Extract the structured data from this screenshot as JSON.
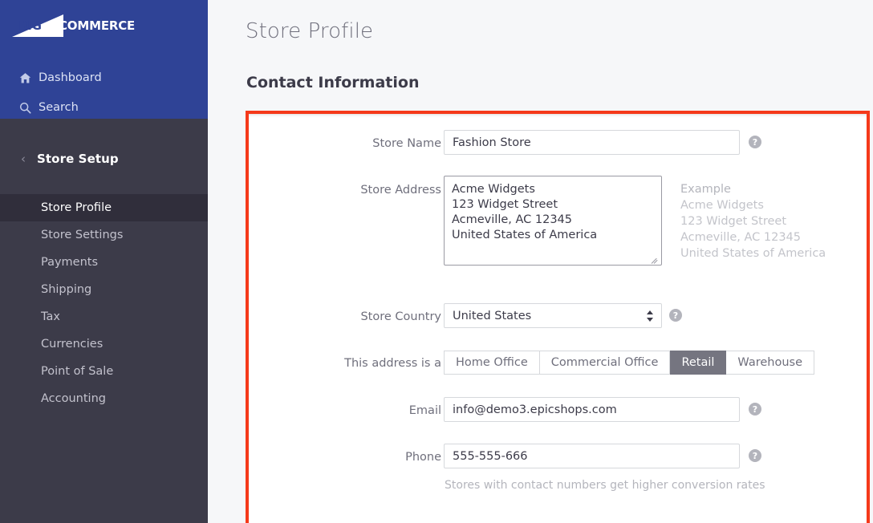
{
  "brand": {
    "logo_big": "BIG",
    "logo_rest": "COMMERCE"
  },
  "sidebar": {
    "top_items": [
      {
        "label": "Dashboard",
        "icon": "home-icon"
      },
      {
        "label": "Search",
        "icon": "search-icon"
      }
    ],
    "section": {
      "label": "Store Setup",
      "back_icon": "chevron-left-icon"
    },
    "items": [
      {
        "label": "Store Profile",
        "active": true
      },
      {
        "label": "Store Settings",
        "active": false
      },
      {
        "label": "Payments",
        "active": false
      },
      {
        "label": "Shipping",
        "active": false
      },
      {
        "label": "Tax",
        "active": false
      },
      {
        "label": "Currencies",
        "active": false
      },
      {
        "label": "Point of Sale",
        "active": false
      },
      {
        "label": "Accounting",
        "active": false
      }
    ]
  },
  "main": {
    "page_title": "Store Profile",
    "section_title": "Contact Information"
  },
  "form": {
    "store_name": {
      "label": "Store Name",
      "value": "Fashion Store",
      "help_icon": "question-mark-icon"
    },
    "store_address": {
      "label": "Store Address",
      "value": "Acme Widgets\n123 Widget Street\nAcmeville, AC 12345\nUnited States of America",
      "example_heading": "Example",
      "example_lines": [
        "Acme Widgets",
        "123 Widget Street",
        "Acmeville, AC 12345",
        "United States of America"
      ]
    },
    "store_country": {
      "label": "Store Country",
      "value": "United States",
      "help_icon": "question-mark-icon"
    },
    "address_type": {
      "label": "This address is a",
      "options": [
        "Home Office",
        "Commercial Office",
        "Retail",
        "Warehouse"
      ],
      "selected": "Retail"
    },
    "email": {
      "label": "Email",
      "value": "info@demo3.epicshops.com",
      "help_icon": "question-mark-icon"
    },
    "phone": {
      "label": "Phone",
      "value": "555-555-666",
      "help_icon": "question-mark-icon",
      "helper_text": "Stores with contact numbers get higher conversion rates"
    }
  },
  "colors": {
    "sidebar_top": "#2f4396",
    "sidebar": "#3c3b49",
    "sidebar_active": "#302e3b",
    "annotation": "#f5391a",
    "segment_active": "#757580"
  }
}
